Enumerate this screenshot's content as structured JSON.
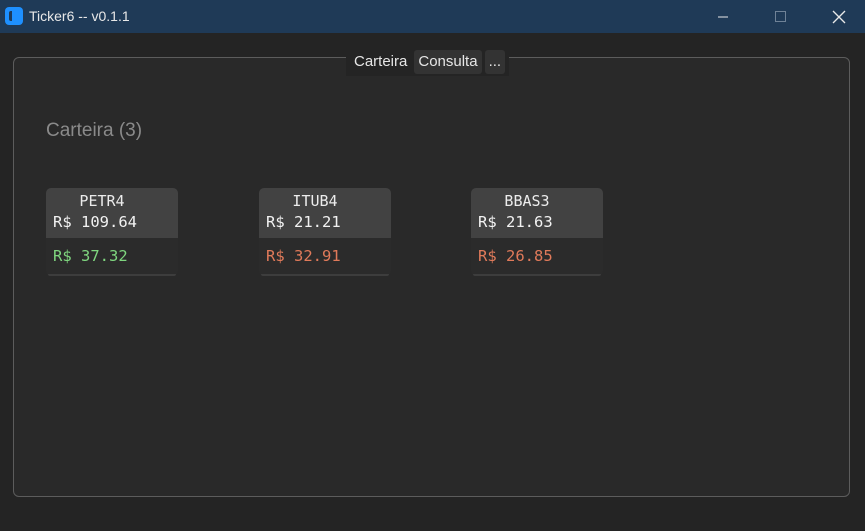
{
  "window": {
    "title": "Ticker6 -- v0.1.1"
  },
  "tabs": [
    {
      "label": "Carteira",
      "active": true
    },
    {
      "label": "Consulta",
      "active": false
    },
    {
      "label": "...",
      "active": false
    }
  ],
  "portfolio": {
    "title": "Carteira (3)",
    "cards": [
      {
        "ticker": "PETR4",
        "price": "R$ 109.64",
        "value": "R$ 37.32",
        "value_color": "#7fd67f"
      },
      {
        "ticker": "ITUB4",
        "price": "R$ 21.21",
        "value": "R$ 32.91",
        "value_color": "#e07a5a"
      },
      {
        "ticker": "BBAS3",
        "price": "R$ 21.63",
        "value": "R$ 26.85",
        "value_color": "#e07a5a"
      }
    ]
  },
  "colors": {
    "titlebar": "#1f3a57",
    "accent": "#1e90ff",
    "positive": "#7fd67f",
    "negative": "#e07a5a"
  }
}
